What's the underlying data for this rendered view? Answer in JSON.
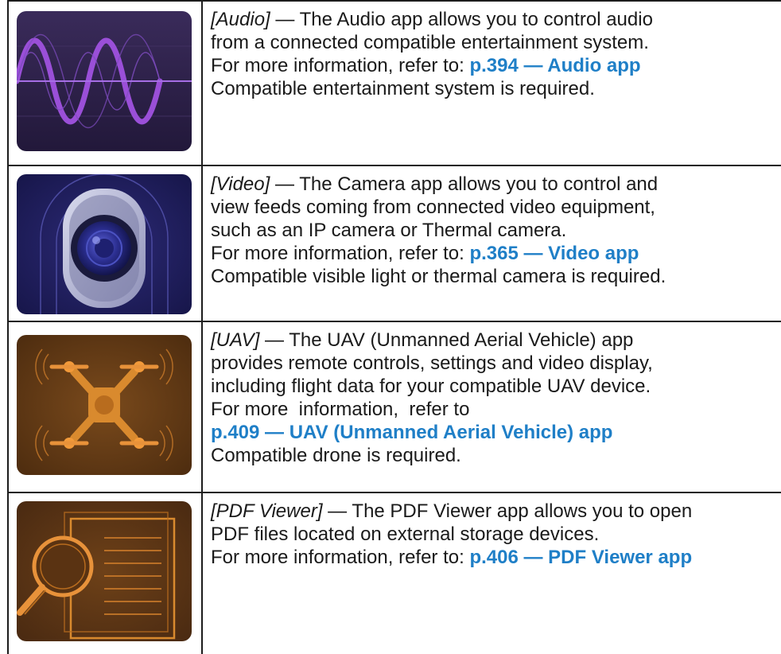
{
  "apps": [
    {
      "tag": "[Audio]",
      "desc_first": " — The Audio app allows you to control audio",
      "desc_lines": [
        "from a connected compatible entertainment system."
      ],
      "ref_prefix": "For more information, refer to:",
      "link": "p.394 — Audio app",
      "requirement": "Compatible entertainment system is required.",
      "icon": "audio-waveform-icon"
    },
    {
      "tag": "[Video]",
      "desc_first": " — The Camera app allows you to control and",
      "desc_lines": [
        "view feeds coming from connected video equipment,",
        "such as an IP camera or Thermal camera."
      ],
      "ref_prefix": "For more information, refer to:",
      "link": "p.365 — Video app",
      "requirement": "Compatible visible light or thermal camera is required.",
      "icon": "camera-lens-icon"
    },
    {
      "tag": "[UAV]",
      "desc_first": " — The UAV (Unmanned Aerial Vehicle) app",
      "desc_lines": [
        "provides remote controls, settings and video display,",
        "including flight data for your compatible UAV device."
      ],
      "ref_prefix": "For more  information,  refer to",
      "link": "p.409 — UAV (Unmanned Aerial Vehicle) app",
      "requirement": "Compatible drone is required.",
      "icon": "drone-icon"
    },
    {
      "tag": "[PDF Viewer]",
      "desc_first": " — The PDF Viewer app allows you to open",
      "desc_lines": [
        "PDF files located on external storage devices."
      ],
      "ref_prefix": "For more information, refer to:",
      "link": "p.406 — PDF Viewer app",
      "requirement": "",
      "icon": "pdf-magnifier-icon"
    }
  ],
  "colors": {
    "link": "#1f7fc7",
    "border": "#1c1c1c",
    "audio_bg": "#2b1f44",
    "video_bg": "#1f1d5c",
    "uav_bg": "#5e3713",
    "pdf_bg": "#5a3514"
  }
}
